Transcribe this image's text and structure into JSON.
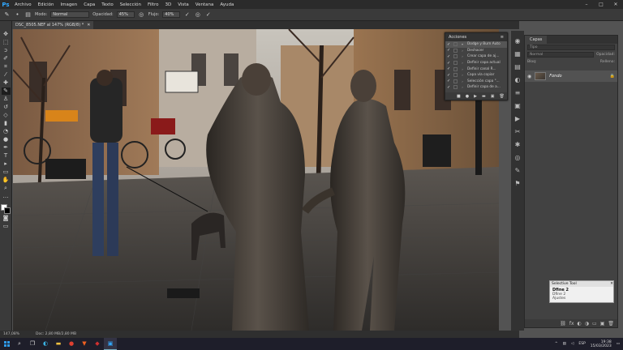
{
  "app": {
    "logo": "Ps",
    "menu": [
      "Archivo",
      "Edición",
      "Imagen",
      "Capa",
      "Texto",
      "Selección",
      "Filtro",
      "3D",
      "Vista",
      "Ventana",
      "Ayuda"
    ],
    "window_controls": [
      "–",
      "□",
      "✕"
    ]
  },
  "options": {
    "mode_label": "Modo:",
    "mode_value": "Normal",
    "opacity_label": "Opacidad:",
    "opacity_value": "45%",
    "flow_label": "Flujo:",
    "flow_value": "40%"
  },
  "document": {
    "tab_title": "DSC_8505.NEF al 147% (RGB/8) *",
    "tab_close": "✕"
  },
  "status": {
    "zoom": "147,08%",
    "doc": "Doc: 2,80 MB/2,80 MB"
  },
  "actions_panel": {
    "title": "Acciones",
    "menu_icon": "≡",
    "items": [
      {
        "label": "Dodge y Burn Auto",
        "check": true,
        "expand": "▾",
        "top": true
      },
      {
        "label": "Deshacer",
        "check": true,
        "expand": "›",
        "top": false
      },
      {
        "label": "Crear capa de aj...",
        "check": true,
        "expand": "›",
        "top": false
      },
      {
        "label": "Definir capa actual",
        "check": true,
        "expand": "›",
        "top": false
      },
      {
        "label": "Definir canal R...",
        "check": true,
        "expand": "›",
        "top": false
      },
      {
        "label": "Capa vía copiar",
        "check": true,
        "expand": "›",
        "top": false
      },
      {
        "label": "Selección capa \"...",
        "check": true,
        "expand": "›",
        "top": false
      },
      {
        "label": "Definir capa de a...",
        "check": true,
        "expand": "›",
        "top": false
      }
    ],
    "bottom_icons": [
      "■",
      "●",
      "▶",
      "▬",
      "▣",
      "🗑"
    ]
  },
  "layers_panel": {
    "tabs": [
      "Capas"
    ],
    "search_placeholder": "Tipo",
    "blend_mode": "Normal",
    "opacity_label": "Opacidad:",
    "lock_label": "Bloq:",
    "fill_label": "Relleno:",
    "layer_name": "Fondo",
    "bottom_icons": [
      "⛓",
      "fx",
      "◐",
      "◑",
      "▭",
      "▣",
      "🗑"
    ]
  },
  "selective_tool": {
    "title": "Selective Tool",
    "close": "✕",
    "heading": "Dfine 2",
    "sub": "Dfine 2",
    "sub2": "Ajustes"
  },
  "taskbar": {
    "time": "19:38",
    "date": "15/03/2023",
    "lang": "ESP"
  },
  "colors": {
    "accent": "#31a8ff"
  }
}
